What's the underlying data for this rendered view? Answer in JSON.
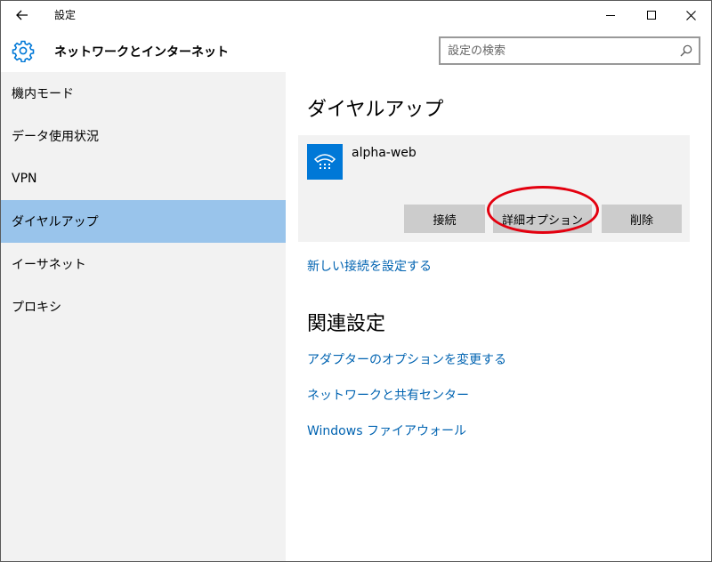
{
  "titlebar": {
    "back_icon": "arrow-left-icon",
    "title": "設定",
    "minimize_icon": "minimize-icon",
    "maximize_icon": "maximize-icon",
    "close_icon": "close-icon"
  },
  "header": {
    "icon": "gear-icon",
    "title": "ネットワークとインターネット",
    "search": {
      "placeholder": "設定の検索",
      "value": "",
      "icon": "search-icon"
    }
  },
  "sidebar": {
    "items": [
      {
        "label": "機内モード",
        "active": false
      },
      {
        "label": "データ使用状況",
        "active": false
      },
      {
        "label": "VPN",
        "active": false
      },
      {
        "label": "ダイヤルアップ",
        "active": true
      },
      {
        "label": "イーサネット",
        "active": false
      },
      {
        "label": "プロキシ",
        "active": false
      }
    ]
  },
  "main": {
    "title": "ダイヤルアップ",
    "connection": {
      "name": "alpha-web",
      "icon": "phone-icon",
      "buttons": {
        "connect": "接続",
        "advanced": "詳細オプション",
        "delete": "削除"
      }
    },
    "new_connection_link": "新しい接続を設定する",
    "related_title": "関連設定",
    "related_links": [
      "アダプターのオプションを変更する",
      "ネットワークと共有センター",
      "Windows ファイアウォール"
    ]
  },
  "colors": {
    "accent": "#0078d7",
    "link": "#0063b1",
    "sidebar_bg": "#f2f2f2",
    "active_item": "#99c4eb",
    "highlight": "#e3000f"
  }
}
